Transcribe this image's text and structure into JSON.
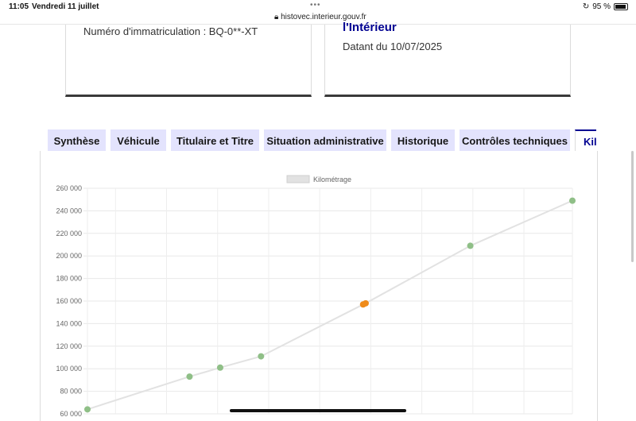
{
  "status_bar": {
    "time": "11:05",
    "date": "Vendredi 11 juillet",
    "url": "histovec.interieur.gouv.fr",
    "battery": "95 %",
    "battery_level": 0.95
  },
  "card_left": {
    "text": "Numéro d'immatriculation : BQ-0**-XT"
  },
  "card_right": {
    "title": "l'Intérieur",
    "date": "Datant du 10/07/2025"
  },
  "tabs": [
    {
      "label": "Synthèse"
    },
    {
      "label": "Véhicule"
    },
    {
      "label": "Titulaire et Titre"
    },
    {
      "label": "Situation administrative"
    },
    {
      "label": "Historique"
    },
    {
      "label": "Contrôles techniques"
    },
    {
      "label": "Kilométrage",
      "active": true
    }
  ],
  "colors": {
    "accent": "#000091",
    "tab_bg": "#e3e3fd",
    "point_ok": "#8fbf87",
    "point_alert": "#ef8b1a",
    "line": "#e2e2e2"
  },
  "chart_data": {
    "type": "line",
    "legend": "Kilométrage",
    "legend_position": "top",
    "grid": true,
    "ylim": [
      60000,
      260000
    ],
    "yticks": [
      "60 000",
      "80 000",
      "100 000",
      "120 000",
      "140 000",
      "160 000",
      "180 000",
      "200 000",
      "220 000",
      "240 000",
      "260 000"
    ],
    "points": [
      {
        "x": 0.0,
        "y": 64000,
        "status": "ok"
      },
      {
        "x": 2.0,
        "y": 93000,
        "status": "ok"
      },
      {
        "x": 2.6,
        "y": 101000,
        "status": "ok"
      },
      {
        "x": 3.4,
        "y": 111000,
        "status": "ok"
      },
      {
        "x": 5.4,
        "y": 157000,
        "status": "alert"
      },
      {
        "x": 5.45,
        "y": 158000,
        "status": "alert"
      },
      {
        "x": 7.5,
        "y": 209000,
        "status": "ok"
      },
      {
        "x": 9.5,
        "y": 249000,
        "status": "ok"
      }
    ]
  }
}
